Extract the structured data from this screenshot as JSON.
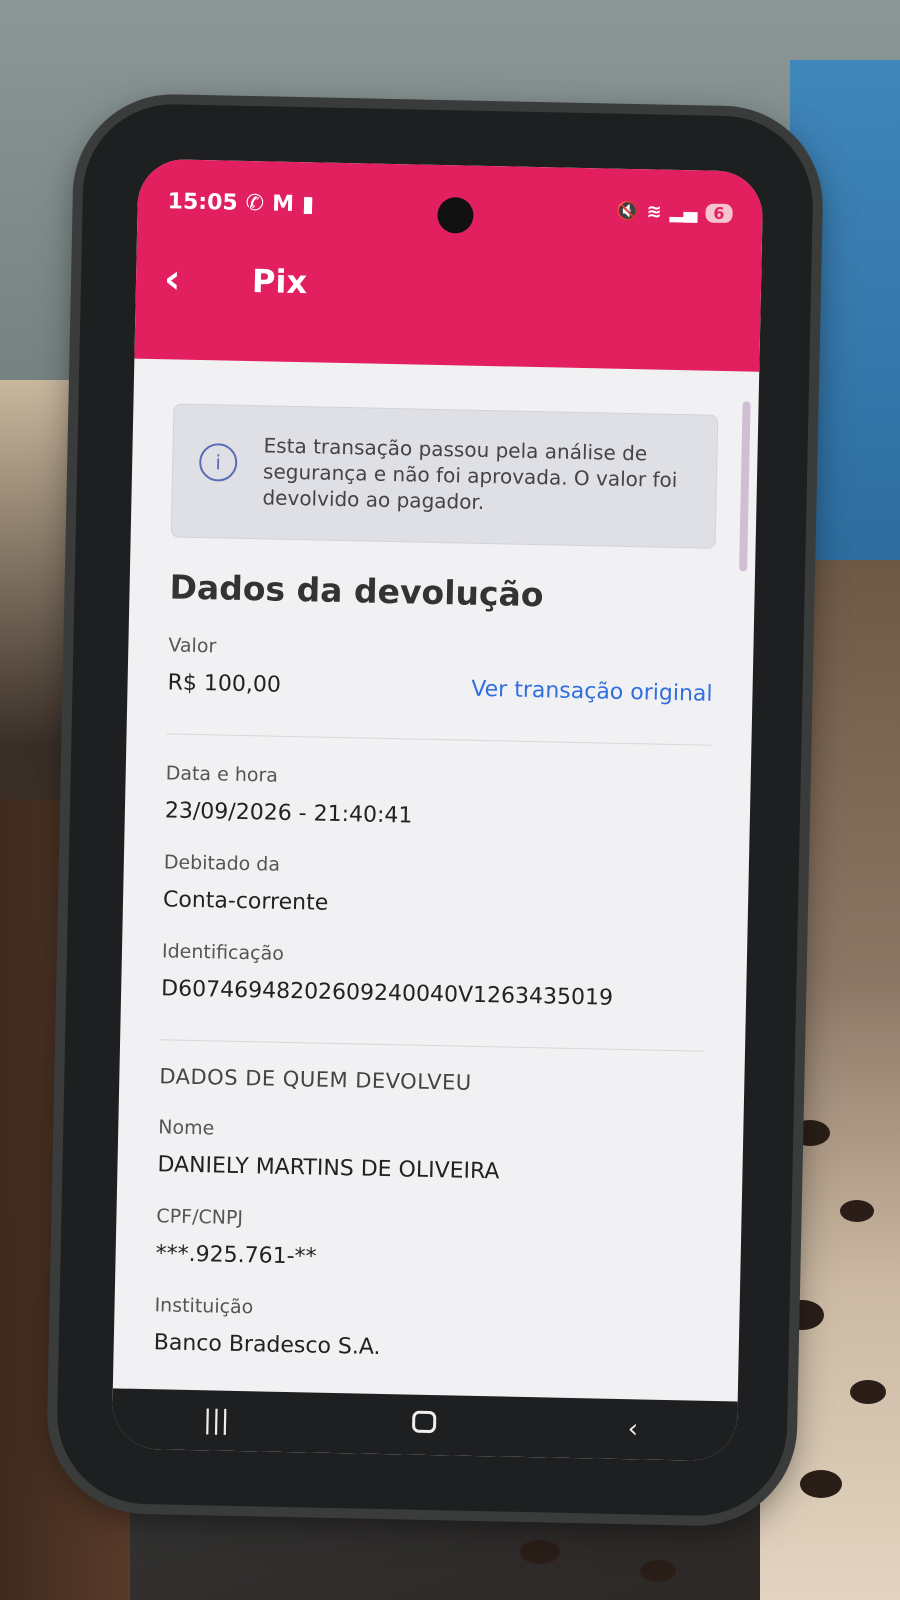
{
  "status": {
    "time": "15:05",
    "left_icons": [
      "whatsapp-icon",
      "gmail-icon",
      "battery-saver-icon"
    ],
    "right_icons": [
      "mute-icon",
      "wifi-icon",
      "signal-icon"
    ],
    "battery": "6"
  },
  "header": {
    "title": "Pix",
    "color": "#e3205f"
  },
  "notice": {
    "text": "Esta transação passou pela análise de segurança e não foi aprovada. O valor foi devolvido ao pagador."
  },
  "refund": {
    "title": "Dados da devolução",
    "amount_label": "Valor",
    "amount_value": "R$ 100,00",
    "view_original_link": "Ver transação original",
    "datetime_label": "Data e hora",
    "datetime_value": "23/09/2026 - 21:40:41",
    "debited_label": "Debitado da",
    "debited_value": "Conta-corrente",
    "id_label": "Identificação",
    "id_value": "D60746948202609240040V1263435019"
  },
  "returner": {
    "header": "DADOS DE QUEM DEVOLVEU",
    "name_label": "Nome",
    "name_value": "DANIELY MARTINS DE OLIVEIRA",
    "doc_label": "CPF/CNPJ",
    "doc_value": "***.925.761-**",
    "institution_label": "Instituição",
    "institution_value": "Banco Bradesco S.A."
  },
  "nav": {
    "recents": "|||",
    "back": "‹"
  }
}
